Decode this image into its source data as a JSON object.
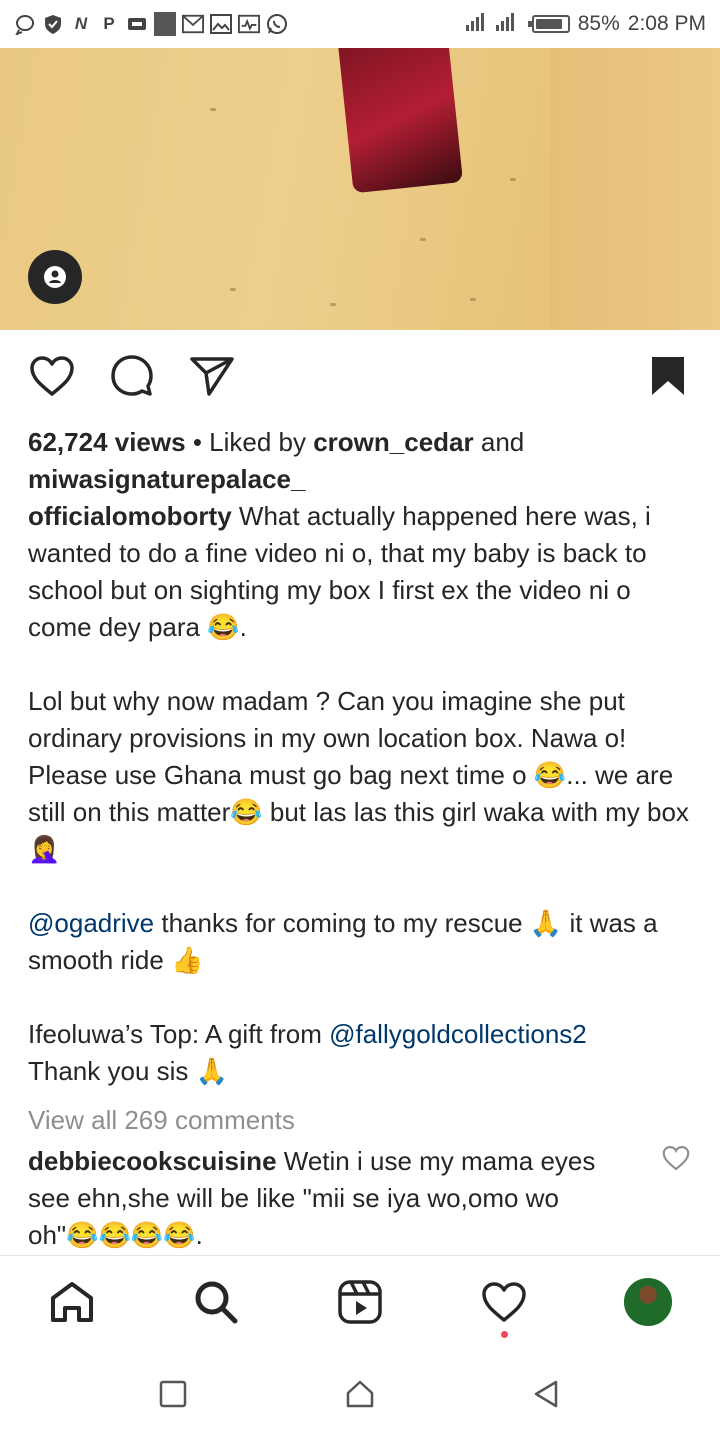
{
  "status_bar": {
    "battery": "85%",
    "time": "2:08 PM",
    "notification_icons": [
      "message-icon",
      "shield-icon",
      "n-icon",
      "p-icon",
      "sim-icon",
      "square-icon",
      "gmail-icon",
      "gallery-icon",
      "pulse-icon",
      "whatsapp-icon"
    ]
  },
  "post": {
    "stats": {
      "views": "62,724 views",
      "liked_by_prefix": "Liked by",
      "liker_1": "crown_cedar",
      "and": "and",
      "liker_2": "miwasignaturepalace_"
    },
    "caption": {
      "username": "officialomoborty",
      "p1": "What actually happened here was, i wanted to do a fine video ni o, that my baby is back to school but on sighting my box I first ex the video ni o come dey para 😂.",
      "p2": "Lol but why now madam ? Can you imagine she put ordinary provisions in my own location box. Nawa o! Please use Ghana must go bag next time o 😂... we are still on this matter😂 but las las this girl waka with my box 🤦‍♀️",
      "p3_mention": "@ogadrive",
      "p3_text": "thanks for coming to my rescue 🙏 it was a smooth ride 👍",
      "p4_text": "Ifeoluwa’s Top:  A gift from",
      "p4_mention": "@fallygoldcollections2",
      "p4_tail": "Thank you sis 🙏"
    },
    "view_all": "View all 269 comments",
    "comment": {
      "username": "debbiecookscuisine",
      "text": "Wetin i use my mama eyes see ehn,she will be like \"mii se iya wo,omo wo oh\"😂😂😂😂."
    }
  },
  "colors": {
    "text": "#262626",
    "mention": "#00376b",
    "muted": "#8e8e8e",
    "notification_dot": "#ed4956"
  }
}
